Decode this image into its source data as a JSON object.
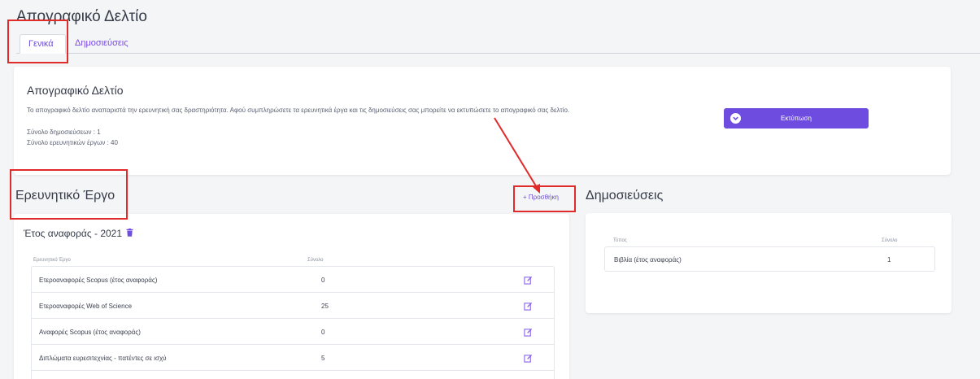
{
  "page_title": "Απογραφικό Δελτίο",
  "tabs": [
    {
      "label": "Γενικά",
      "active": true
    },
    {
      "label": "Δημοσιεύσεις",
      "active": false
    }
  ],
  "summary": {
    "title": "Απογραφικό Δελτίο",
    "description": "Το απογραφικό δελτίο αναπαριστά την ερευνητική σας δραστηριότητα. Αφού συμπληρώσετε τα ερευνητικά έργα και τις δημοσιεύσεις σας μπορείτε να εκτυπώσετε το απογραφικό σας δελτίο.",
    "total_publications": "Σύνολο δημοσιεύσεων : 1",
    "total_research": "Σύνολο ερευνητικών έργων : 40",
    "print_label": "Εκτύπωση"
  },
  "research": {
    "title": "Ερευνητικό Έργο",
    "add_label": "+ Προσθήκη",
    "year_label": "Έτος αναφοράς - 2021",
    "col_name": "Ερευνητικό Έργο",
    "col_total": "Σύνολο",
    "rows": [
      {
        "name": "Ετεροαναφορές Scopus (έτος αναφοράς)",
        "value": "0"
      },
      {
        "name": "Ετεροαναφορές Web of Science",
        "value": "25"
      },
      {
        "name": "Αναφορές Scopus (έτος αναφοράς)",
        "value": "0"
      },
      {
        "name": "Διπλώματα ευρεσιτεχνίας - πατέντες σε ισχύ",
        "value": "5"
      }
    ]
  },
  "publications": {
    "title": "Δημοσιεύσεις",
    "col_type": "Τύπος",
    "col_total": "Σύνολο",
    "rows": [
      {
        "name": "Βιβλία (έτος αναφοράς)",
        "value": "1"
      }
    ]
  },
  "colors": {
    "accent": "#6f4ce0",
    "highlight": "#e12a2a",
    "icon_accent": "#8a63e6"
  },
  "icons": [
    "chevron-circle-icon",
    "trash-icon",
    "edit-icon"
  ]
}
